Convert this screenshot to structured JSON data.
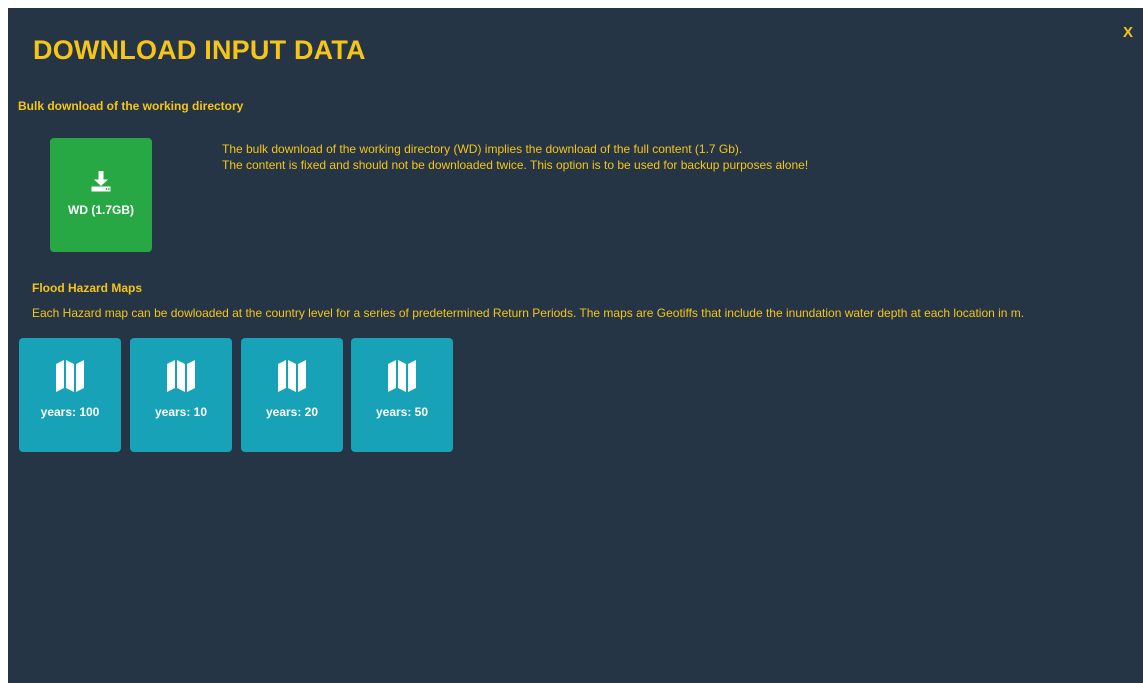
{
  "modal": {
    "title": "DOWNLOAD INPUT DATA",
    "close_label": "X"
  },
  "bulk": {
    "heading": "Bulk download of the working directory",
    "description_line1": "The bulk download of the working directory (WD) implies the download of the full content (1.7 Gb).",
    "description_line2": "The content is fixed and should not be downloaded twice. This option is to be used for backup purposes alone!",
    "button": {
      "label": "WD (1.7GB)",
      "icon": "download-icon",
      "color": "#28a745"
    }
  },
  "flood": {
    "heading": "Flood Hazard Maps",
    "description": "Each Hazard map can be dowloaded at the country level for a series of predetermined Return Periods. The maps are Geotiffs that include the inundation water depth at each location in m.",
    "tile_color": "#17a2b8",
    "tiles": [
      {
        "label": "years: 100",
        "icon": "map-icon"
      },
      {
        "label": "years: 10",
        "icon": "map-icon"
      },
      {
        "label": "years: 20",
        "icon": "map-icon"
      },
      {
        "label": "years: 50",
        "icon": "map-icon"
      }
    ]
  },
  "colors": {
    "background": "#253545",
    "accent": "#f5c518"
  }
}
